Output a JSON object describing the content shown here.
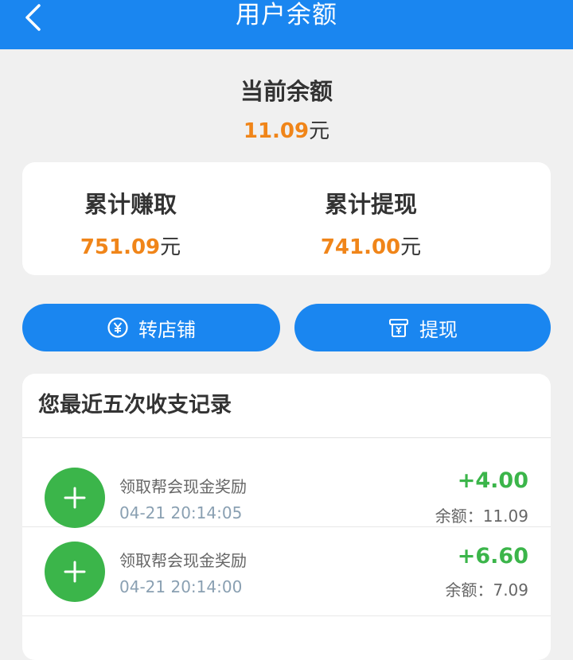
{
  "header": {
    "title": "用户余额",
    "back_icon": "chevron-left-icon"
  },
  "balance": {
    "title": "当前余额",
    "amount": "11.09",
    "unit": "元"
  },
  "stats": {
    "earned": {
      "label": "累计赚取",
      "amount": "751.09",
      "unit": "元"
    },
    "withdrawn": {
      "label": "累计提现",
      "amount": "741.00",
      "unit": "元"
    }
  },
  "buttons": {
    "transfer": {
      "label": "转店铺",
      "icon": "yen-coin-icon"
    },
    "withdraw": {
      "label": "提现",
      "icon": "withdraw-icon"
    }
  },
  "records": {
    "title": "您最近五次收支记录",
    "items": [
      {
        "desc": "领取帮会现金奖励",
        "time": "04-21 20:14:05",
        "amount": "+4.00",
        "balance": "余额：11.09"
      },
      {
        "desc": "领取帮会现金奖励",
        "time": "04-21 20:14:00",
        "amount": "+6.60",
        "balance": "余额：7.09"
      }
    ]
  },
  "colors": {
    "primary": "#1a86f0",
    "amount": "#f08519",
    "income": "#3bb54a"
  }
}
